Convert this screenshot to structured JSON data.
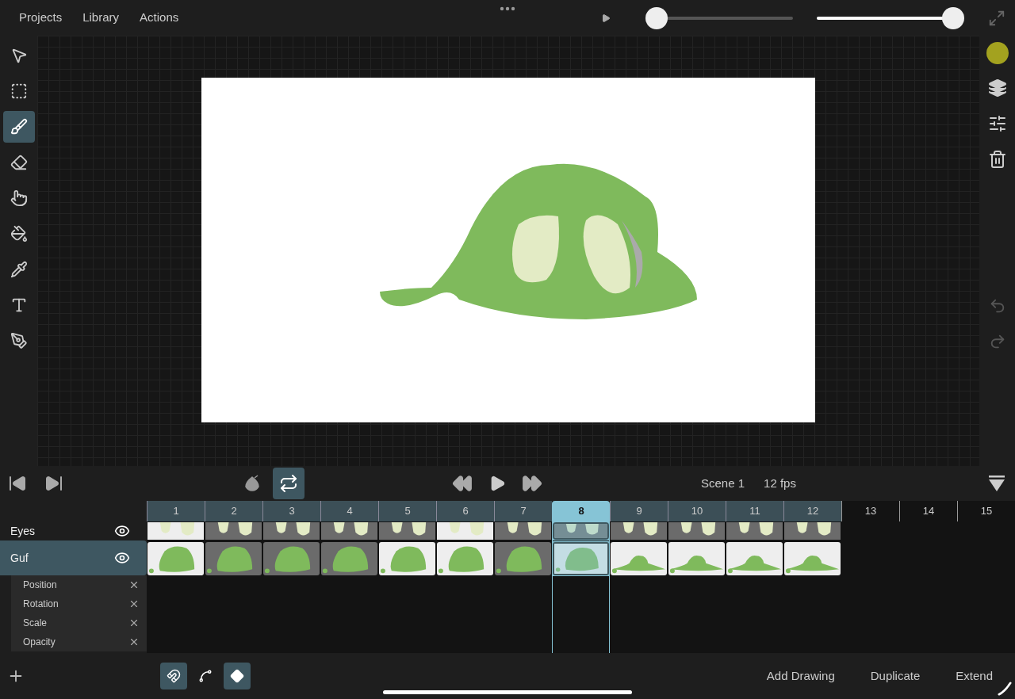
{
  "top_bar": {
    "menu": [
      "Projects",
      "Library",
      "Actions"
    ],
    "sliders": [
      {
        "level": 0
      },
      {
        "level": 1
      }
    ]
  },
  "left_tools": [
    {
      "kind": "select",
      "selected": false
    },
    {
      "kind": "marquee",
      "selected": false
    },
    {
      "kind": "brush",
      "selected": true
    },
    {
      "kind": "eraser",
      "selected": false
    },
    {
      "kind": "smudge",
      "selected": false
    },
    {
      "kind": "fill",
      "selected": false
    },
    {
      "kind": "eyedropper",
      "selected": false
    },
    {
      "kind": "text",
      "selected": false
    },
    {
      "kind": "pen",
      "selected": false
    }
  ],
  "right_tools": {
    "color": "#a3a21f",
    "undo_disabled": true,
    "redo_disabled": true
  },
  "playback": {
    "onion_skin": false,
    "loop": true,
    "scene": "Scene 1",
    "fps": "12 fps"
  },
  "timeline": {
    "frames": [
      {
        "label": "1",
        "selected": false
      },
      {
        "label": "2",
        "selected": false
      },
      {
        "label": "3",
        "selected": false
      },
      {
        "label": "4",
        "selected": false
      },
      {
        "label": "5",
        "selected": false
      },
      {
        "label": "6",
        "selected": false
      },
      {
        "label": "7",
        "selected": false
      },
      {
        "label": "8",
        "selected": true
      },
      {
        "label": "9",
        "selected": false
      },
      {
        "label": "10",
        "selected": false
      },
      {
        "label": "11",
        "selected": false
      },
      {
        "label": "12",
        "selected": false
      }
    ],
    "empty_frames": [
      "13",
      "14",
      "15"
    ],
    "layers": [
      {
        "name": "Eyes",
        "selected": false,
        "kind": "eyes",
        "cells": [
          {
            "kind": "key"
          },
          {
            "kind": "hold"
          },
          {
            "kind": "hold"
          },
          {
            "kind": "hold"
          },
          {
            "kind": "hold"
          },
          {
            "kind": "key"
          },
          {
            "kind": "hold"
          },
          {
            "kind": "hold"
          },
          {
            "kind": "hold"
          },
          {
            "kind": "hold"
          },
          {
            "kind": "hold"
          },
          {
            "kind": "hold"
          }
        ]
      },
      {
        "name": "Guf",
        "selected": true,
        "kind": "body",
        "cells": [
          {
            "kind": "key"
          },
          {
            "kind": "hold"
          },
          {
            "kind": "hold"
          },
          {
            "kind": "hold"
          },
          {
            "kind": "key"
          },
          {
            "kind": "key"
          },
          {
            "kind": "hold"
          },
          {
            "kind": "key"
          },
          {
            "kind": "key"
          },
          {
            "kind": "key"
          },
          {
            "kind": "key"
          },
          {
            "kind": "key"
          }
        ]
      }
    ],
    "properties": [
      "Position",
      "Rotation",
      "Scale",
      "Opacity"
    ]
  },
  "bottom_bar": {
    "modes": [
      {
        "kind": "magnet",
        "selected": true
      },
      {
        "kind": "path",
        "selected": false
      },
      {
        "kind": "keyframe",
        "selected": true
      }
    ],
    "actions": [
      "Add Drawing",
      "Duplicate",
      "Extend"
    ]
  }
}
